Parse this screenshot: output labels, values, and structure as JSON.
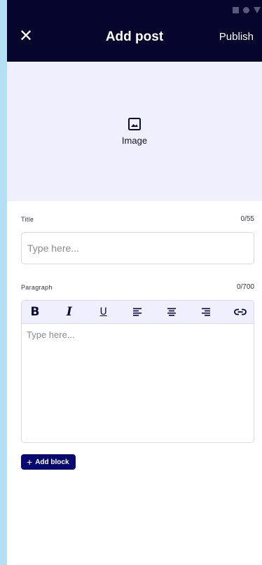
{
  "header": {
    "title": "Add post",
    "close_label": "✕",
    "publish_label": "Publish"
  },
  "image_upload": {
    "label": "Image",
    "icon": "image-icon"
  },
  "title_field": {
    "label": "Title",
    "counter": "0/55",
    "placeholder": "Type here...",
    "value": ""
  },
  "paragraph_field": {
    "label": "Paragraph",
    "counter": "0/700",
    "placeholder": "Type here...",
    "value": "",
    "toolbar": [
      {
        "name": "bold",
        "label": "B"
      },
      {
        "name": "italic",
        "label": "I"
      },
      {
        "name": "underline",
        "label": "U"
      },
      {
        "name": "align-left"
      },
      {
        "name": "align-center"
      },
      {
        "name": "align-right"
      },
      {
        "name": "link"
      }
    ]
  },
  "add_block": {
    "plus": "+",
    "label": "Add block"
  },
  "colors": {
    "header_bg": "#05052e",
    "image_area_bg": "#efeffe",
    "accent": "#080870",
    "page_bg": "#b3e0f5"
  }
}
